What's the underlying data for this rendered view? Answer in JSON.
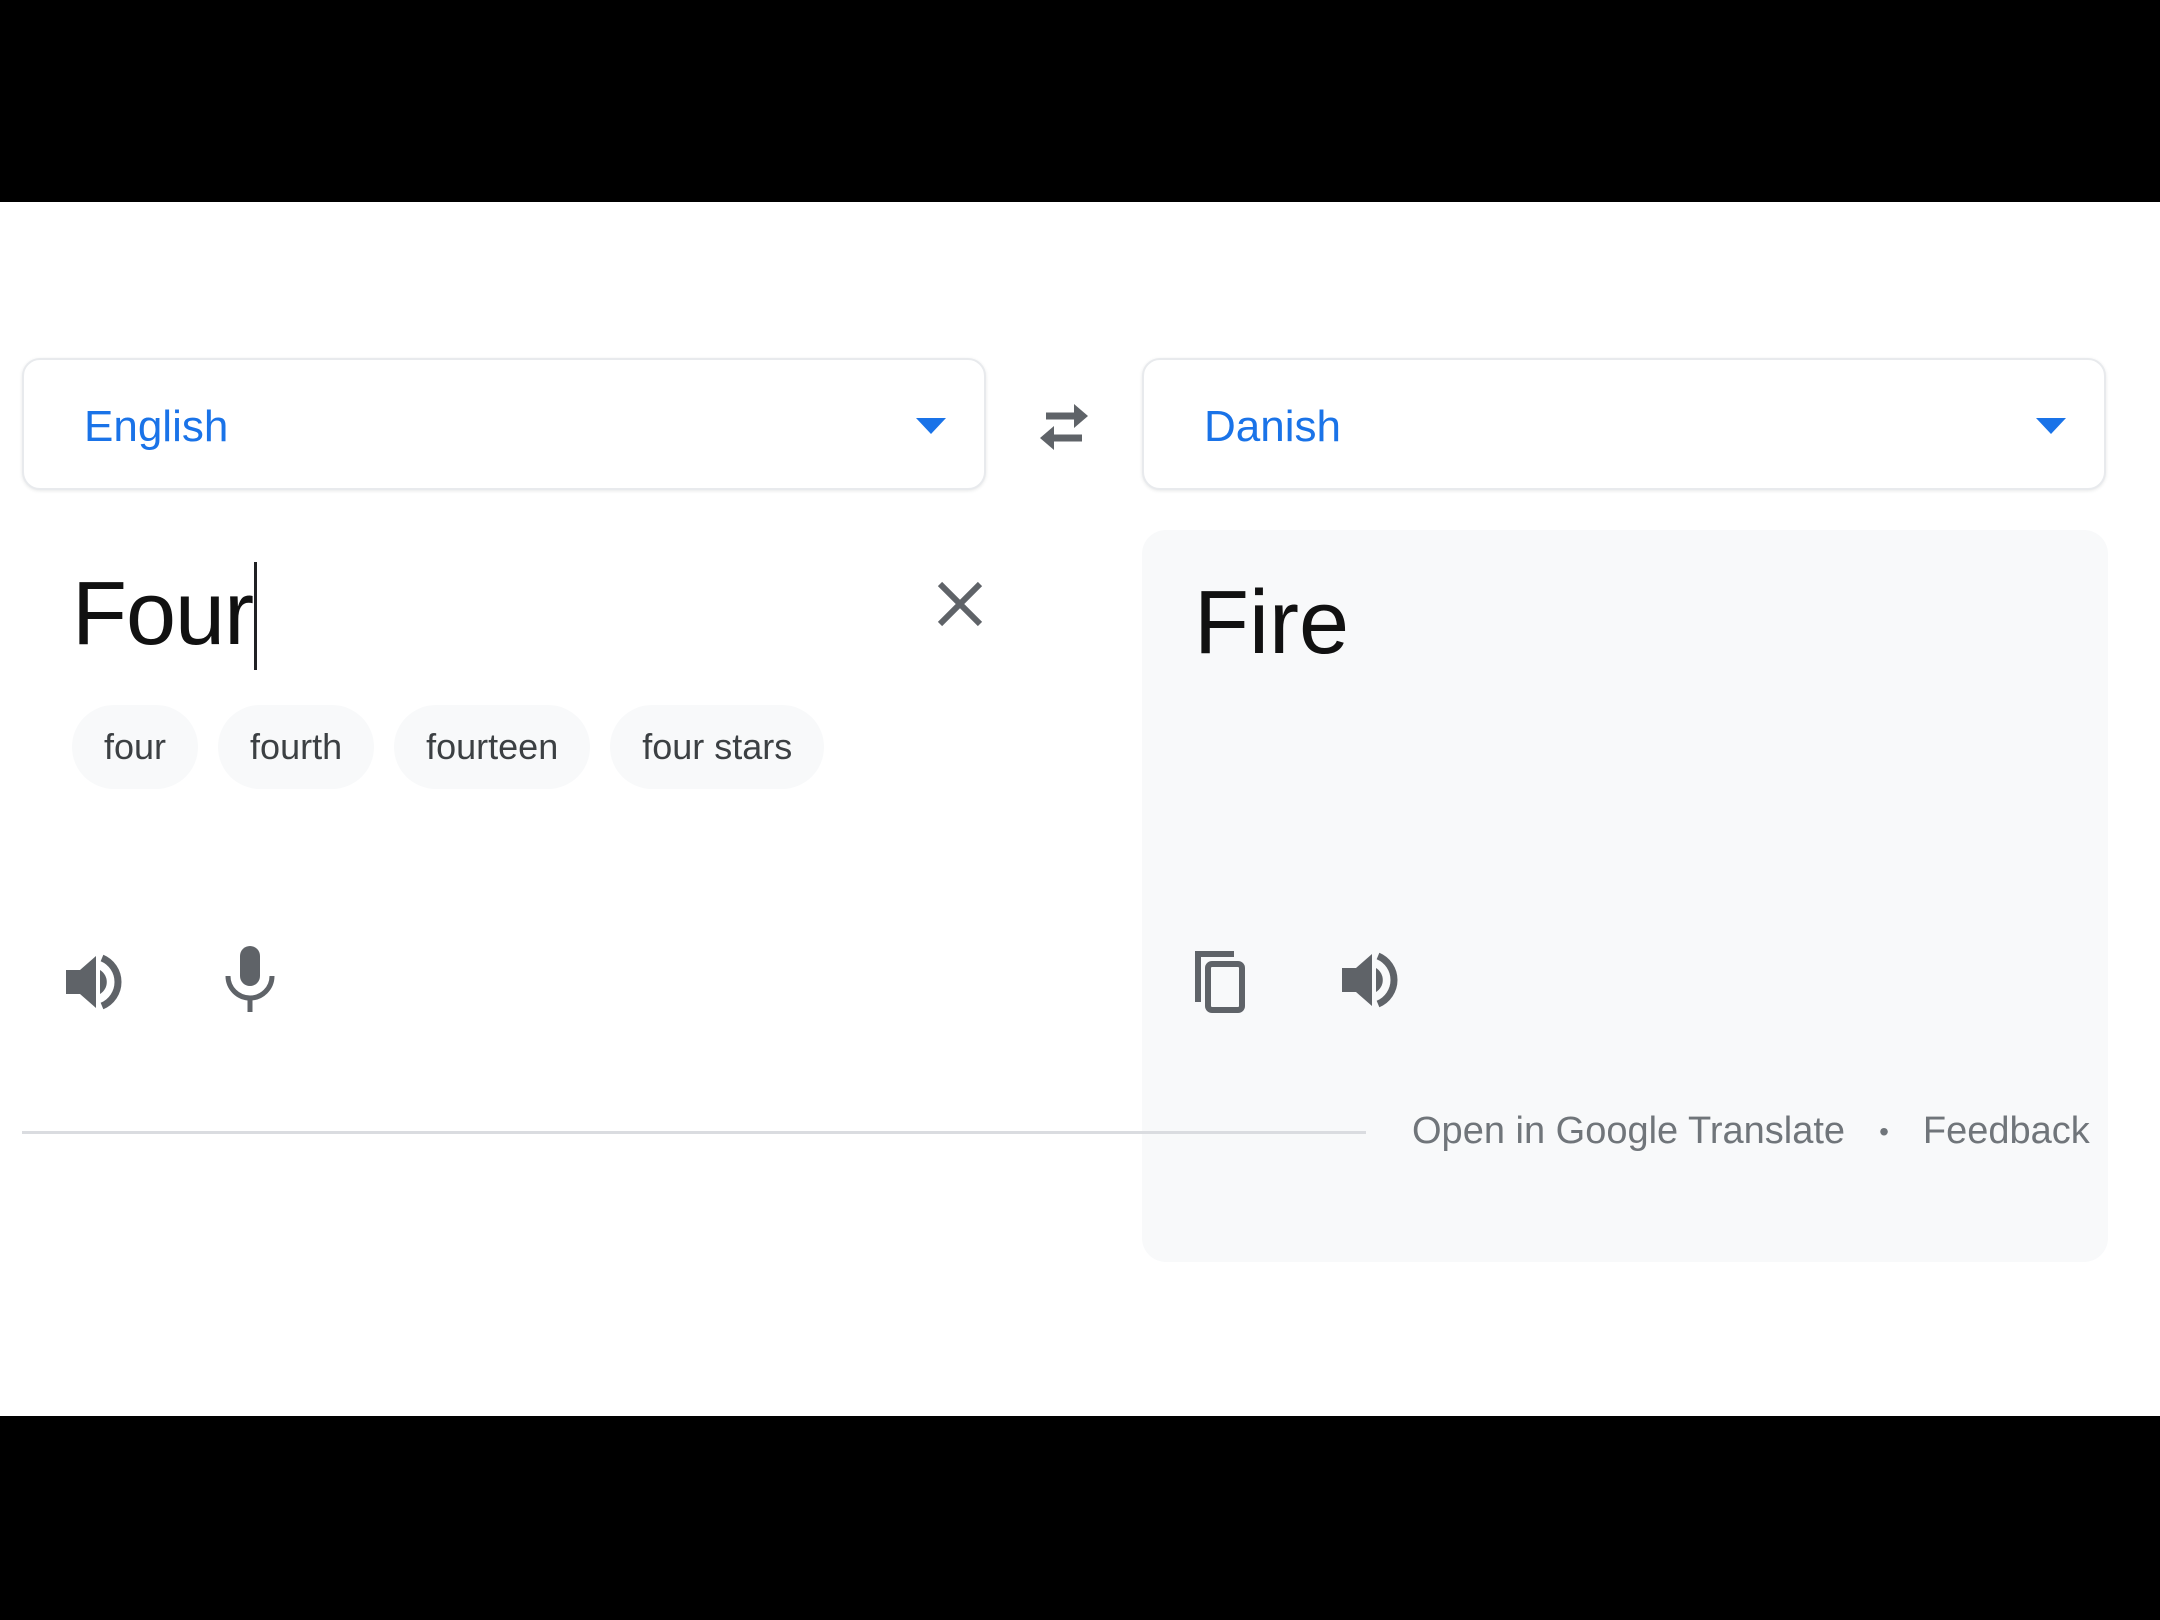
{
  "translator": {
    "source_language": "English",
    "target_language": "Danish",
    "source_text": "Four",
    "translated_text": "Fire",
    "suggestions": [
      "four",
      "fourth",
      "fourteen",
      "four stars"
    ]
  },
  "icons": {
    "swap": "swap-languages-icon",
    "clear": "close-icon",
    "source_speaker": "speaker-icon",
    "microphone": "microphone-icon",
    "copy": "copy-icon",
    "target_speaker": "speaker-icon"
  },
  "footer": {
    "open_link": "Open in Google Translate",
    "separator": "•",
    "feedback_link": "Feedback"
  },
  "colors": {
    "accent": "#1a73e8",
    "icon_gray": "#5f6368",
    "output_bg": "#f8f9fa"
  }
}
